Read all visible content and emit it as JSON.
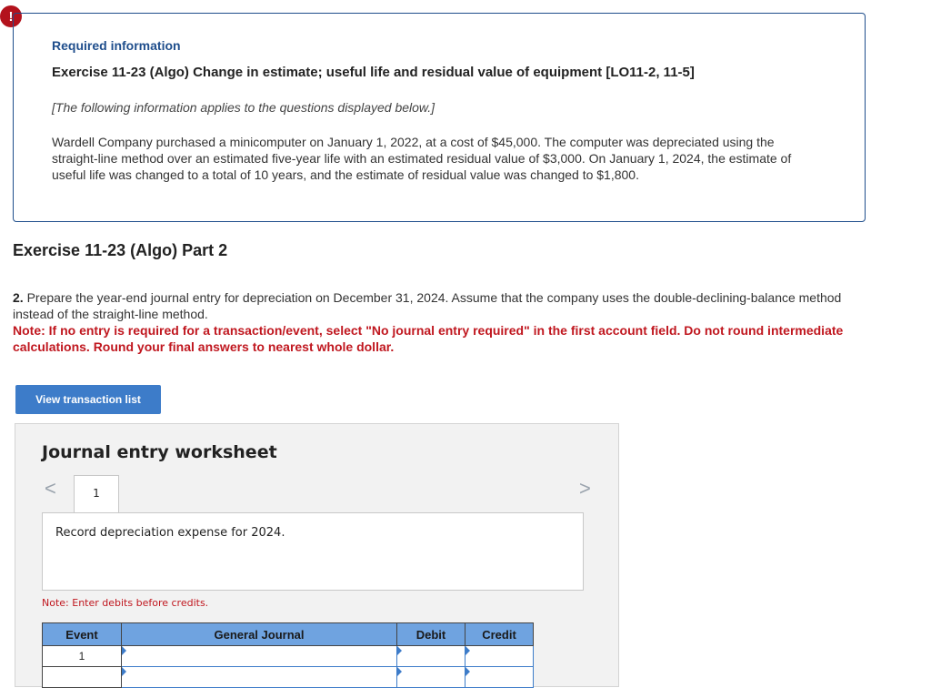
{
  "alert": {
    "glyph": "!"
  },
  "info": {
    "label": "Required information",
    "title": "Exercise 11-23 (Algo) Change in estimate; useful life and residual value of equipment [LO11-2, 11-5]",
    "applies": "[The following information applies to the questions displayed below.]",
    "body": "Wardell Company purchased a minicomputer on January 1, 2022, at a cost of $45,000. The computer was depreciated using the straight-line method over an estimated five-year life with an estimated residual value of $3,000. On January 1, 2024, the estimate of useful life was changed to a total of 10 years, and the estimate of residual value was changed to $1,800."
  },
  "part": {
    "heading": "Exercise 11-23 (Algo) Part 2",
    "instruction_num": "2.",
    "instruction": "Prepare the year-end journal entry for depreciation on December 31, 2024. Assume that the company uses the double-declining-balance method instead of the straight-line method.",
    "note": "Note: If no entry is required for a transaction/event, select \"No journal entry required\" in the first account field. Do not round intermediate calculations. Round your final answers to nearest whole dollar."
  },
  "view_button": "View transaction list",
  "worksheet": {
    "title": "Journal entry worksheet",
    "prev": "<",
    "next": ">",
    "tab": "1",
    "description": "Record depreciation expense for 2024.",
    "note": "Note: Enter debits before credits.",
    "columns": [
      "Event",
      "General Journal",
      "Debit",
      "Credit"
    ],
    "rows": [
      {
        "event": "1"
      },
      {
        "event": ""
      }
    ]
  }
}
